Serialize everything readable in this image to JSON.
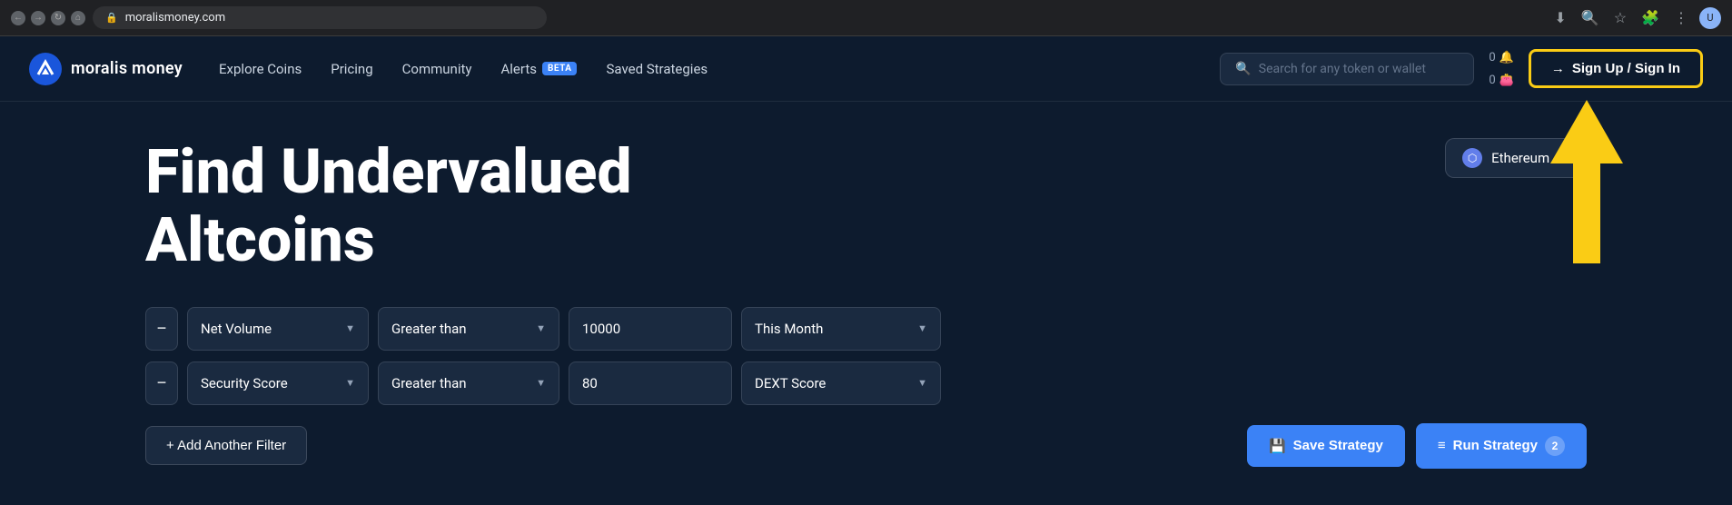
{
  "browser": {
    "url": "moralismoney.com",
    "controls": {
      "back": "←",
      "forward": "→",
      "refresh": "↻",
      "home": "⌂"
    },
    "actions": {
      "download": "⬇",
      "search": "🔍",
      "extensions": "🧩",
      "bookmark": "☆",
      "menu": "⋮"
    }
  },
  "header": {
    "logo_text": "moralis money",
    "nav_items": [
      {
        "label": "Explore Coins",
        "has_badge": false
      },
      {
        "label": "Pricing",
        "has_badge": false
      },
      {
        "label": "Community",
        "has_badge": false
      },
      {
        "label": "Alerts",
        "has_badge": true,
        "badge_text": "BETA"
      },
      {
        "label": "Saved Strategies",
        "has_badge": false
      }
    ],
    "search_placeholder": "Search for any token or wallet",
    "header_count_1": "0",
    "header_count_2": "0",
    "sign_btn_label": "Sign Up / Sign In",
    "sign_btn_icon": "→"
  },
  "main": {
    "title": "Find Undervalued Altcoins",
    "network_selector": {
      "label": "Ethereum"
    },
    "filters": [
      {
        "metric": "Net Volume",
        "operator": "Greater than",
        "value": "10000",
        "period": "This Month"
      },
      {
        "metric": "Security Score",
        "operator": "Greater than",
        "value": "80",
        "period": "DEXT Score"
      }
    ],
    "add_filter_label": "+ Add Another Filter",
    "save_strategy_label": "Save Strategy",
    "run_strategy_label": "Run Strategy",
    "run_count": "2"
  },
  "colors": {
    "bg_dark": "#0d1b2e",
    "bg_card": "#1a2a40",
    "accent_blue": "#3b82f6",
    "yellow": "#facc15",
    "border": "rgba(255,255,255,0.12)"
  }
}
